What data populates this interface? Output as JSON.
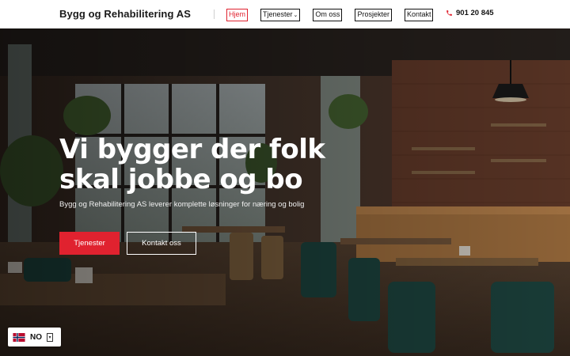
{
  "header": {
    "brand": "Bygg og Rehabilitering AS",
    "nav": [
      {
        "label": "Hjem",
        "active": true
      },
      {
        "label": "Tjenester",
        "has_dropdown": true
      },
      {
        "label": "Om oss"
      },
      {
        "label": "Prosjekter"
      },
      {
        "label": "Kontakt"
      }
    ],
    "phone": "901 20 845",
    "phone_icon": "phone-icon"
  },
  "hero": {
    "title_line1": "Vi bygger der folk",
    "title_line2": "skal jobbe og bo",
    "subtitle": "Bygg og Rehabilitering AS leverer komplette løsninger for næring og bolig",
    "primary_button": "Tjenester",
    "secondary_button": "Kontakt oss",
    "background": "restaurant-interior-photo"
  },
  "language": {
    "code": "NO",
    "flag": "norway-flag-icon"
  },
  "colors": {
    "accent": "#e0222f",
    "header_bg": "#ffffff",
    "hero_text": "#ffffff"
  }
}
